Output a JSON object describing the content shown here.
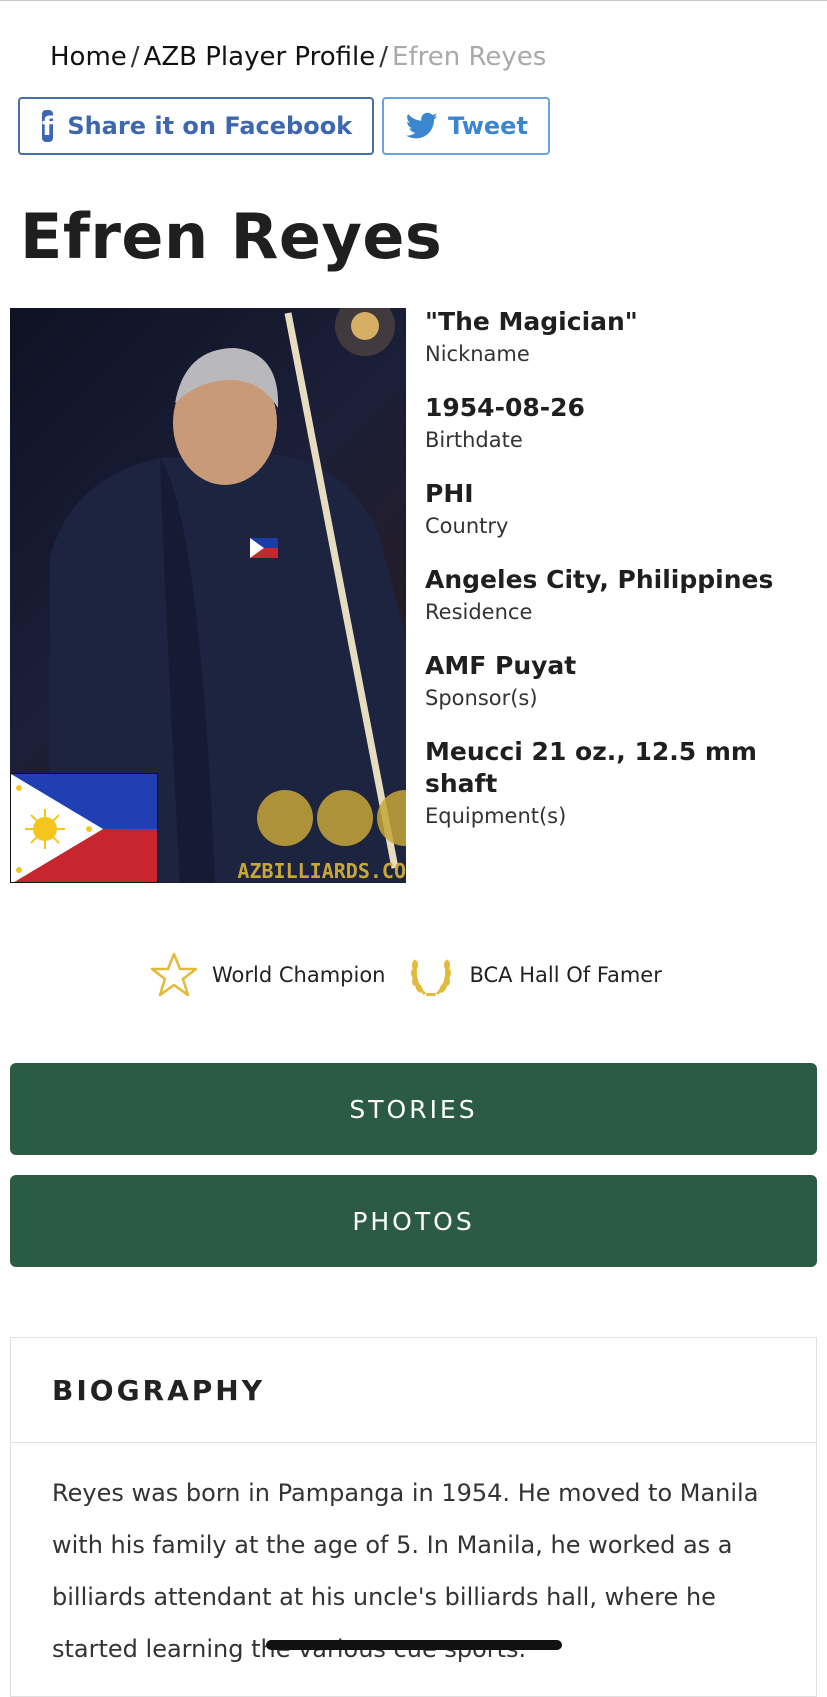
{
  "breadcrumb": {
    "items": [
      "Home",
      "AZB Player Profile"
    ],
    "separator": "/",
    "current": "Efren Reyes"
  },
  "share": {
    "facebook_label": "Share it on Facebook",
    "twitter_label": "Tweet"
  },
  "player": {
    "name": "Efren Reyes",
    "facts": [
      {
        "value": "\"The Magician\"",
        "label": "Nickname"
      },
      {
        "value": "1954-08-26",
        "label": "Birthdate"
      },
      {
        "value": "PHI",
        "label": "Country"
      },
      {
        "value": "Angeles City, Philippines",
        "label": "Residence"
      },
      {
        "value": "AMF Puyat",
        "label": "Sponsor(s)"
      },
      {
        "value": "Meucci 21 oz., 12.5 mm shaft",
        "label": "Equipment(s)"
      }
    ],
    "photo_watermark": "AZBILLIARDS.CO"
  },
  "badges": [
    {
      "icon": "star-icon",
      "label": "World Champion"
    },
    {
      "icon": "laurel-icon",
      "label": "BCA Hall Of Famer"
    }
  ],
  "buttons": {
    "stories": "STORIES",
    "photos": "PHOTOS"
  },
  "biography": {
    "title": "BIOGRAPHY",
    "text": "Reyes was born in Pampanga in 1954. He moved to Manila with his family at the age of 5. In Manila, he worked as a billiards attendant at his uncle's billiards hall, where he started learning the various cue sports."
  },
  "colors": {
    "accent_green": "#2b5b45",
    "facebook_blue": "#3d67b0",
    "twitter_blue": "#3a86d0",
    "gold": "#e3b93a"
  }
}
